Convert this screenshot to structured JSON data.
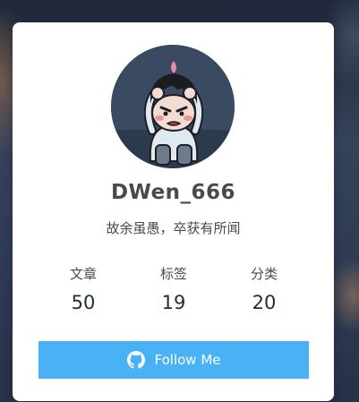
{
  "profile": {
    "avatar_icon": "cartoon-avatar",
    "name": "DWen_666",
    "motto": "故余虽愚，卒获有所闻"
  },
  "stats": [
    {
      "label": "文章",
      "value": "50"
    },
    {
      "label": "标签",
      "value": "19"
    },
    {
      "label": "分类",
      "value": "20"
    }
  ],
  "follow": {
    "icon": "github-icon",
    "label": "Follow Me"
  },
  "colors": {
    "accent": "#49b1f5",
    "card_bg": "#ffffff",
    "text": "#4c4948"
  }
}
